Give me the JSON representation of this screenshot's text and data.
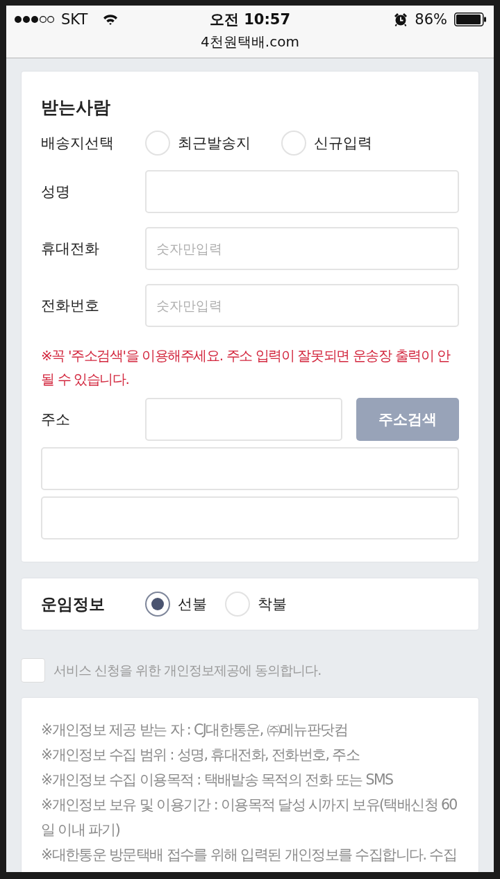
{
  "status_bar": {
    "carrier": "SKT",
    "time": "오전 10:57",
    "battery": "86%"
  },
  "address_bar": {
    "url": "4천원택배.com"
  },
  "recipient": {
    "title": "받는사람",
    "delivery_choice": {
      "label": "배송지선택",
      "options": [
        {
          "label": "최근발송지",
          "selected": false
        },
        {
          "label": "신규입력",
          "selected": false
        }
      ]
    },
    "fields": [
      {
        "label": "성명"
      },
      {
        "label": "휴대전화",
        "placeholder": "숫자만입력"
      },
      {
        "label": "전화번호",
        "placeholder": "숫자만입력"
      }
    ],
    "warning": "※꼭 '주소검색'을 이용해주세요. 주소 입력이 잘못되면 운송장 출력이 안 될 수 있습니다.",
    "address": {
      "label": "주소",
      "fields": [
        {
          "kind": "search",
          "button": "주소검색"
        },
        {
          "kind": "plain"
        },
        {
          "kind": "plain"
        }
      ]
    }
  },
  "freight": {
    "title": "운임정보",
    "options": [
      {
        "label": "선불",
        "selected": true
      },
      {
        "label": "착불",
        "selected": false
      }
    ]
  },
  "consent": {
    "label": "서비스 신청을 위한 개인정보제공에 동의합니다.",
    "checked": false
  },
  "notice": {
    "lines": [
      "※개인정보 제공 받는 자 : CJ대한통운, ㈜메뉴판닷컴",
      "※개인정보 수집 범위 : 성명, 휴대전화, 전화번호, 주소",
      "※개인정보 수집 이용목적 : 택배발송 목적의 전화 또는 SMS",
      "※개인정보 보유 및 이용기간 : 이용목적 달성 시까지 보유(택배신청 60일 이내 파기)",
      "※대한통운 방문택배 접수를 위해 입력된 개인정보를 수집합니다. 수집"
    ]
  }
}
